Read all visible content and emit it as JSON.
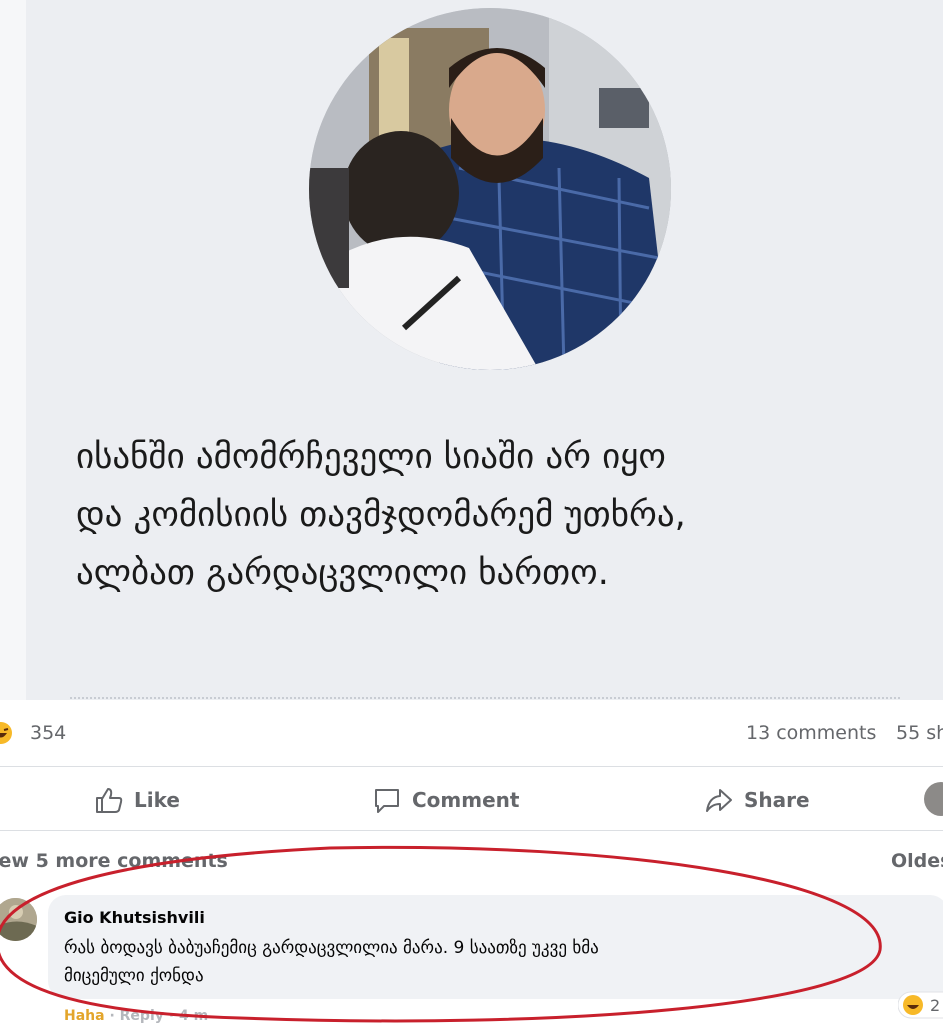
{
  "post": {
    "quote_lines": [
      "ისანში ამომრჩეველი სიაში არ იყო",
      "და კომისიის თავმჯდომარემ უთხრა,",
      "ალბათ გარდაცვლილი ხართო."
    ],
    "quote_mark_color": "#d2234e",
    "card_color": "#eceef2"
  },
  "stats": {
    "reaction_count": "354",
    "comments": "13 comments",
    "shares": "55 sh"
  },
  "actions": {
    "like": "Like",
    "comment": "Comment",
    "share": "Share"
  },
  "comments_section": {
    "view_more": "iew 5 more comments",
    "sort": "Oldes",
    "comment": {
      "author": "Gio Khutsishvili",
      "text_lines": [
        "რას ბოდავს ბაბუაჩემიც გარდაცვლილია მარა. 9 საათზე უკვე ხმა",
        "მიცემული ქონდა"
      ],
      "reaction": "Haha",
      "reply": "Reply",
      "time": "4 m",
      "reaction_count": "2"
    }
  },
  "annotation": {
    "color": "#c8202c"
  }
}
